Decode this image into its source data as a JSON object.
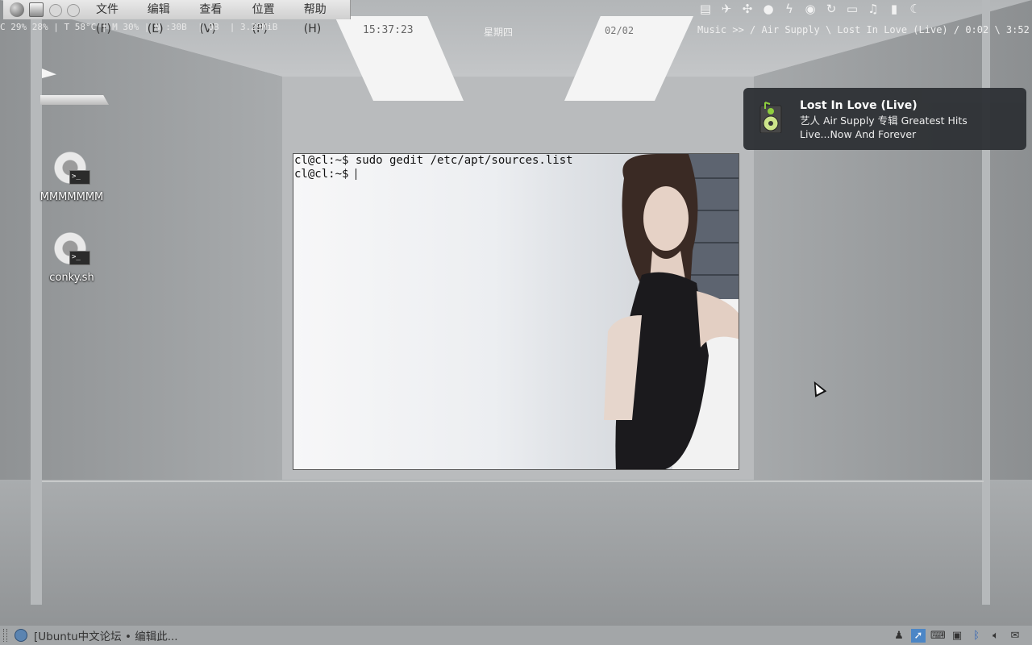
{
  "top_panel": {
    "menus": [
      "文件(F)",
      "编辑(E)",
      "查看(V)",
      "位置(P)",
      "帮助(H)"
    ],
    "tray_icons": [
      "image-icon",
      "airplane-icon",
      "fan-icon",
      "chat-icon",
      "lightning-icon",
      "firefox-icon",
      "refresh-icon",
      "film-icon",
      "music-note-icon",
      "cup-icon",
      "moon-icon"
    ]
  },
  "conky": {
    "stats": "C 29% 28% | T 58°C | M 30% | N :30B  | 0B  | 3.29MiB",
    "clock": "15:37:23",
    "weekday": "星期四",
    "date": "02/02",
    "music": "Music >> / Air Supply \\ Lost In Love (Live) / 0:02 \\ 3:52 |"
  },
  "desktop": {
    "icons": [
      {
        "label": "MMMMMMM"
      },
      {
        "label": "conky.sh"
      }
    ]
  },
  "terminal": {
    "lines": [
      "cl@cl:~$ sudo gedit /etc/apt/sources.list",
      "cl@cl:~$ "
    ]
  },
  "notification": {
    "title": "Lost In Love (Live)",
    "body_line1": "艺人 Air Supply 专辑 Greatest Hits",
    "body_line2": "Live...Now And Forever"
  },
  "bottom_panel": {
    "task_label": "[Ubuntu中文论坛 • 编辑此..."
  }
}
